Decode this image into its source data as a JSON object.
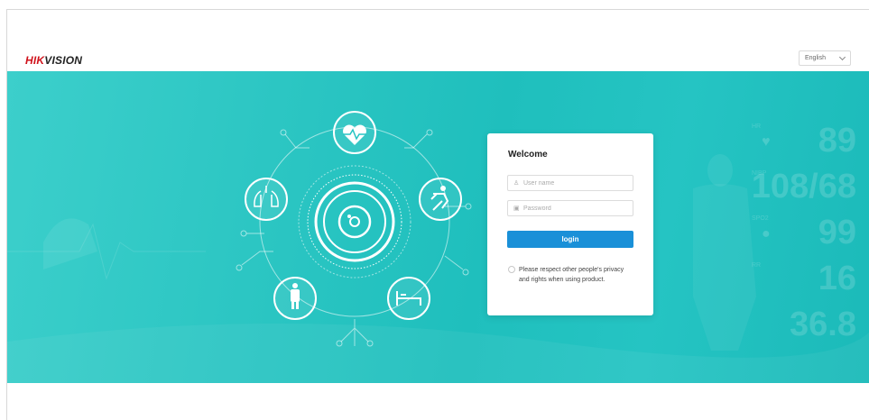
{
  "brand": {
    "hik": "HIK",
    "vision": "VISION"
  },
  "language": {
    "selected": "English"
  },
  "login": {
    "title": "Welcome",
    "username_placeholder": "User name",
    "password_placeholder": "Password",
    "submit_label": "login",
    "agreement_text": "Please respect other people's privacy and rights when using product."
  },
  "background_vitals": [
    "89",
    "108/68",
    "99",
    "16",
    "36.8"
  ],
  "background_vital_labels": [
    "HR",
    "NIBP",
    "SPO2",
    "RR"
  ],
  "colors": {
    "brand_red": "#d0121b",
    "banner_teal": "#2cc6c3",
    "button_blue": "#1a90d8"
  },
  "icons": [
    "heart-pulse-icon",
    "lungs-icon",
    "fall-detection-icon",
    "person-icon",
    "hospital-bed-icon",
    "camera-lens-icon"
  ]
}
